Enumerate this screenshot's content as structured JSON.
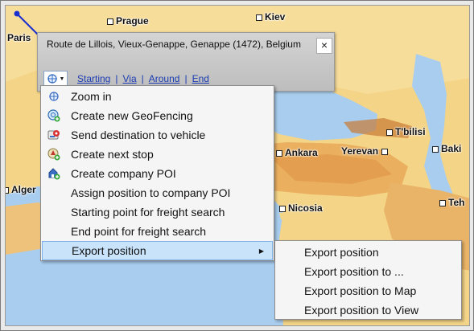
{
  "map": {
    "cities": [
      {
        "name": "Paris"
      },
      {
        "name": "Prague"
      },
      {
        "name": "Kiev"
      },
      {
        "name": "T'bilisi"
      },
      {
        "name": "Ankara"
      },
      {
        "name": "Yerevan"
      },
      {
        "name": "Baki"
      },
      {
        "name": "Alger"
      },
      {
        "name": "Nicosia"
      },
      {
        "name": "Teh"
      }
    ]
  },
  "popup": {
    "address": "Route de Lillois, Vieux-Genappe, Genappe (1472), Belgium",
    "close_label": "×",
    "links": {
      "starting": "Starting",
      "via": "Via",
      "around": "Around",
      "end": "End",
      "separator": "|"
    }
  },
  "context_menu": {
    "items": [
      {
        "label": "Zoom in",
        "icon": "zoom-icon"
      },
      {
        "label": "Create new GeoFencing",
        "icon": "geofencing-icon"
      },
      {
        "label": "Send destination to vehicle",
        "icon": "send-destination-icon"
      },
      {
        "label": "Create next stop",
        "icon": "next-stop-icon"
      },
      {
        "label": "Create company POI",
        "icon": "company-poi-icon"
      },
      {
        "label": "Assign position to company POI",
        "icon": ""
      },
      {
        "label": "Starting point for freight search",
        "icon": ""
      },
      {
        "label": "End point for freight search",
        "icon": ""
      },
      {
        "label": "Export position",
        "icon": "",
        "submenu": true
      }
    ],
    "submenu_arrow": "▶"
  },
  "export_submenu": {
    "items": [
      {
        "label": "Export position"
      },
      {
        "label": "Export position to ..."
      },
      {
        "label": "Export position to Map"
      },
      {
        "label": "Export position to View"
      }
    ]
  },
  "colors": {
    "accent": "#1b3cb3",
    "highlight": "#c9e3fb",
    "sea": "#a9cdee",
    "land": "#f6d98c"
  }
}
